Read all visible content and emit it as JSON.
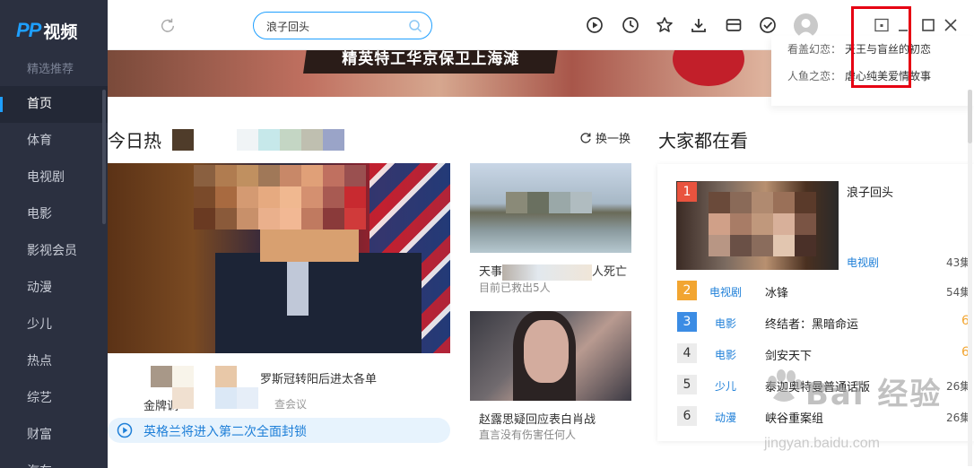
{
  "app": {
    "logo_pp": "PP",
    "logo_text": "视频"
  },
  "sidebar": {
    "section": "精选推荐",
    "items": [
      "首页",
      "体育",
      "电视剧",
      "电影",
      "影视会员",
      "动漫",
      "少儿",
      "热点",
      "综艺",
      "财富",
      "汽车"
    ]
  },
  "search": {
    "value": "浪子回头"
  },
  "banner": {
    "ribbon": "精英特工华京保卫上海滩",
    "side": [
      {
        "label": "看盖幻恋：",
        "title": "天王与盲丝的初恋"
      },
      {
        "label": "人鱼之恋：",
        "title": "虐心纯美爱情故事"
      }
    ]
  },
  "today": {
    "title": "今日热",
    "swap_label": "换一换",
    "big": {
      "line1": "罗斯冠转阳后进太各单",
      "line2": "金牌调",
      "line3": "查会议"
    },
    "news_bar": "英格兰将进入第二次全面封锁",
    "small": [
      {
        "title": "天事",
        "title_end": "人死亡",
        "sub": "目前已救出5人"
      },
      {
        "title": "赵露思疑回应表白肖战",
        "sub": "直言没有伤害任何人"
      }
    ]
  },
  "popular": {
    "title": "大家都在看",
    "top": {
      "rank": "1",
      "name": "浪子回头",
      "cat": "电视剧",
      "ep": "43集"
    },
    "list": [
      {
        "rank": "2",
        "cat": "电视剧",
        "name": "冰锋",
        "ep": "54集"
      },
      {
        "rank": "3",
        "cat": "电影",
        "name": "终结者：黑暗命运",
        "score": "6"
      },
      {
        "rank": "4",
        "cat": "电影",
        "name": "剑安天下",
        "score": "6"
      },
      {
        "rank": "5",
        "cat": "少儿",
        "name": "泰迦奥特曼普通话版",
        "ep": "26集"
      },
      {
        "rank": "6",
        "cat": "动漫",
        "name": "峡谷重案组",
        "ep": "26集"
      }
    ]
  },
  "watermark": {
    "text": "Bai 经验",
    "url": "jingyan.baidu.com"
  }
}
